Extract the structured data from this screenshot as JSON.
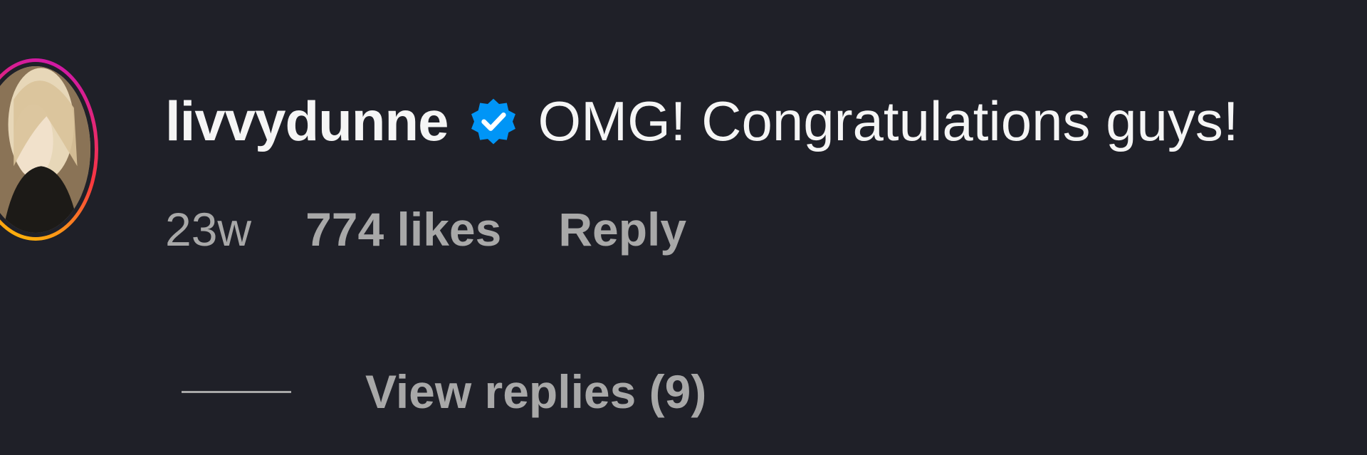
{
  "comment": {
    "username": "livvydunne",
    "verified_icon": "verified-badge-icon",
    "text": "OMG! Congratulations guys!",
    "time": "23w",
    "likes": "774 likes",
    "reply_label": "Reply",
    "view_replies_label": "View replies (9)"
  },
  "colors": {
    "background": "#1f2028",
    "primary_text": "#f5f5f5",
    "secondary_text": "#a8a8a8",
    "verified_blue": "#0095f6",
    "story_ring_start": "#c913b9",
    "story_ring_end": "#fecd00"
  }
}
